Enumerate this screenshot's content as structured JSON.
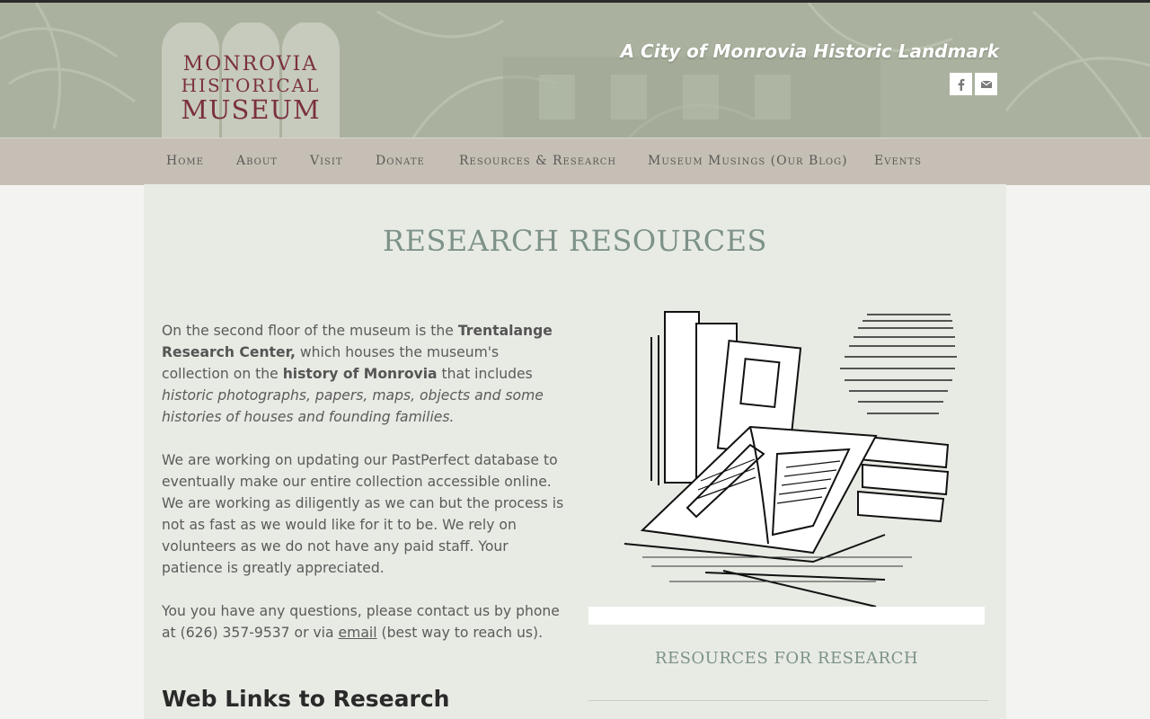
{
  "header": {
    "logo": {
      "line1": "MONROVIA",
      "line2": "HISTORICAL",
      "line3": "MUSEUM"
    },
    "tagline": "A City of Monrovia Historic Landmark",
    "social": [
      {
        "icon": "facebook-icon",
        "label": "f"
      },
      {
        "icon": "mail-icon",
        "label": "email"
      }
    ]
  },
  "nav": {
    "items": [
      {
        "label": "Home"
      },
      {
        "label": "About"
      },
      {
        "label": "Visit"
      },
      {
        "label": "Donate"
      },
      {
        "label": "Resources & Research"
      },
      {
        "label": "Museum Musings (Our Blog)"
      },
      {
        "label": "Events"
      }
    ]
  },
  "main": {
    "title": "RESEARCH RESOURCES",
    "intro": {
      "t1": "On the second floor of the museum is the ",
      "b1": "Trentalange Research Center,",
      "t2": " which houses the museum's collection on the ",
      "b2": "history of Monrovia",
      "t3": " that includes ",
      "i1": "historic photographs, papers, maps, objects and some histories of houses and founding families."
    },
    "paragraph2": "We are working on updating our PastPerfect database to eventually make our entire collection accessible online.  We are working as diligently as we can but the process is not as fast as we would like for it to be.  We rely on volunteers as we do not have any paid staff.  Your patience is greatly appreciated.",
    "contact": {
      "t1": "You you have any questions, please contact us by phone at (626) 357-9537 or via ",
      "link": "email",
      "t2": " (best way to reach us)."
    },
    "web_links_heading": "Web Links to Research",
    "sidebar_heading": "RESOURCES FOR RESEARCH"
  },
  "colors": {
    "header_bg": "#aeb5a4",
    "nav_bg": "#c6bfb5",
    "content_bg": "#e8ebe4",
    "accent_title": "#7d9289",
    "logo_text": "#7b3040"
  }
}
